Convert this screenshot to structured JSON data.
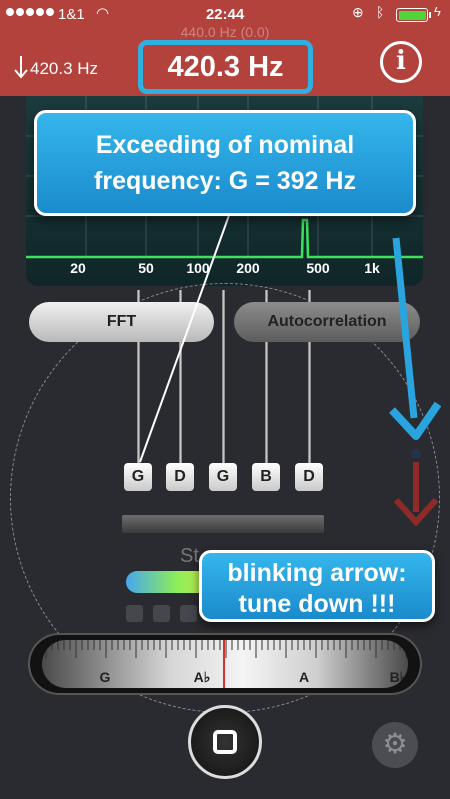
{
  "status_bar": {
    "carrier": "1&1",
    "time": "22:44",
    "icons": [
      "signal-dots-icon",
      "wifi-icon",
      "rotation-lock-icon",
      "bluetooth-icon",
      "battery-icon",
      "charging-bolt-icon"
    ],
    "battery_color": "#4fd53a"
  },
  "header": {
    "sub_reading": "440.0 Hz (0.0)",
    "small_frequency": "420.3 Hz",
    "main_frequency": "420.3 Hz",
    "info_label": "i",
    "background_color": "#b3413c",
    "highlight_color": "#2fb0e0"
  },
  "spectrum": {
    "tick_labels": [
      "20",
      "50",
      "100",
      "200",
      "500",
      "1k"
    ],
    "line_color": "#3ee25a"
  },
  "modes": {
    "fft_label": "FFT",
    "autocorrelation_label": "Autocorrelation"
  },
  "strings": {
    "labels": [
      "G",
      "D",
      "G",
      "B",
      "D"
    ],
    "partial_text": "St"
  },
  "scale": {
    "labels": [
      "G",
      "A♭",
      "A",
      "B♭"
    ],
    "marker_color": "#d9302c"
  },
  "callouts": {
    "top_line1": "Exceeding of nominal",
    "top_line2": "frequency: G = 392 Hz",
    "bottom_line1": "blinking arrow:",
    "bottom_line2": "tune down !!!",
    "color": "#2aa4de"
  },
  "controls": {
    "stop_icon": "stop-square-icon",
    "settings_icon": "gear-icon",
    "settings_glyph": "⚙"
  }
}
